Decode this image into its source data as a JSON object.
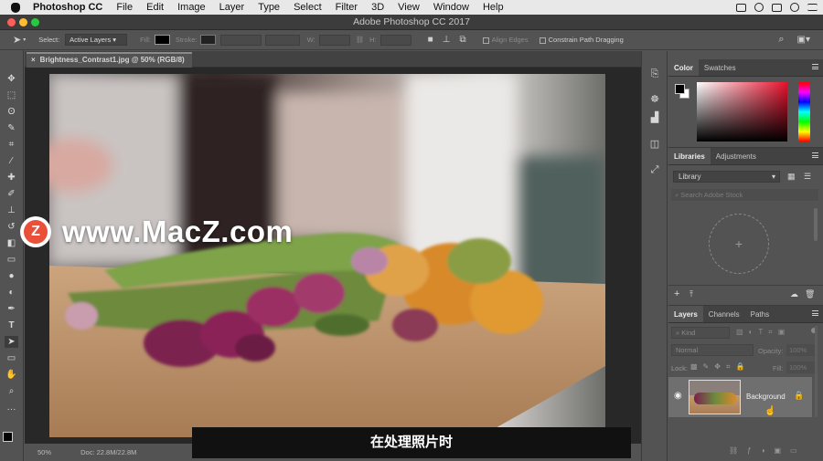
{
  "os_menubar": {
    "app_name": "Photoshop CC",
    "menus": [
      "File",
      "Edit",
      "Image",
      "Layer",
      "Type",
      "Select",
      "Filter",
      "3D",
      "View",
      "Window",
      "Help"
    ]
  },
  "window": {
    "title": "Adobe Photoshop CC 2017"
  },
  "options_bar": {
    "select_label": "Select:",
    "select_value": "Active Layers",
    "fill_label": "Fill:",
    "stroke_label": "Stroke:",
    "w_label": "W:",
    "h_label": "H:",
    "align_edges": "Align Edges",
    "constrain": "Constrain Path Dragging"
  },
  "document": {
    "tab_title": "Brightness_Contrast1.jpg @ 50% (RGB/8)",
    "zoom": "50%",
    "doc_info": "Doc: 22.8M/22.8M"
  },
  "color_panel": {
    "tabs": [
      "Color",
      "Swatches"
    ]
  },
  "libraries_panel": {
    "tabs": [
      "Libraries",
      "Adjustments"
    ],
    "library_select": "Library",
    "search_placeholder": "Search Adobe Stock"
  },
  "layers_panel": {
    "tabs": [
      "Layers",
      "Channels",
      "Paths"
    ],
    "kind_filter": "Kind",
    "blend_mode": "Normal",
    "opacity_label": "Opacity:",
    "opacity_value": "100%",
    "lock_label": "Lock:",
    "fill_label": "Fill:",
    "fill_value": "100%",
    "layers": [
      {
        "name": "Background",
        "visible": true,
        "locked": true
      }
    ]
  },
  "watermark": {
    "logo_letter": "Z",
    "text": "www.MacZ.com"
  },
  "subtitle": {
    "text": "在处理照片时"
  },
  "colors": {
    "accent": "#e94f39",
    "panel_bg": "#535353",
    "canvas_bg": "#282828"
  }
}
